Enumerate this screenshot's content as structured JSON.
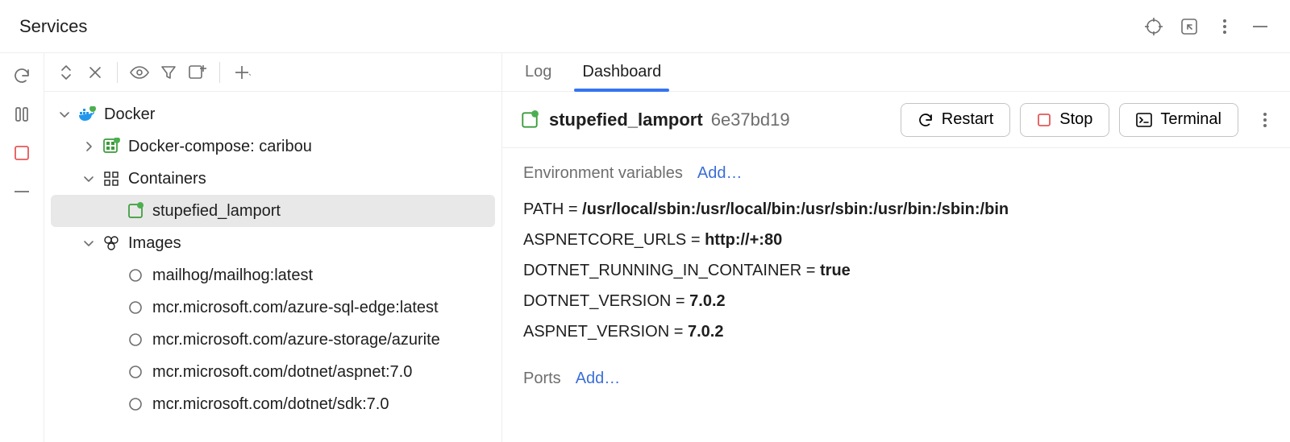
{
  "header": {
    "title": "Services"
  },
  "tree": {
    "root": {
      "label": "Docker",
      "compose": {
        "label": "Docker-compose: caribou"
      },
      "containers": {
        "label": "Containers",
        "items": [
          {
            "name": "stupefied_lamport"
          }
        ]
      },
      "images": {
        "label": "Images",
        "items": [
          {
            "name": "mailhog/mailhog:latest"
          },
          {
            "name": "mcr.microsoft.com/azure-sql-edge:latest"
          },
          {
            "name": "mcr.microsoft.com/azure-storage/azurite"
          },
          {
            "name": "mcr.microsoft.com/dotnet/aspnet:7.0"
          },
          {
            "name": "mcr.microsoft.com/dotnet/sdk:7.0"
          }
        ]
      }
    }
  },
  "detail": {
    "tabs": {
      "log": "Log",
      "dashboard": "Dashboard",
      "active": "dashboard"
    },
    "container": {
      "name": "stupefied_lamport",
      "hash": "6e37bd19"
    },
    "buttons": {
      "restart": "Restart",
      "stop": "Stop",
      "terminal": "Terminal"
    },
    "env": {
      "title": "Environment variables",
      "add": "Add…",
      "vars": [
        {
          "k": "PATH",
          "v": "/usr/local/sbin:/usr/local/bin:/usr/sbin:/usr/bin:/sbin:/bin"
        },
        {
          "k": "ASPNETCORE_URLS",
          "v": "http://+:80"
        },
        {
          "k": "DOTNET_RUNNING_IN_CONTAINER",
          "v": "true"
        },
        {
          "k": "DOTNET_VERSION",
          "v": "7.0.2"
        },
        {
          "k": "ASPNET_VERSION",
          "v": "7.0.2"
        }
      ]
    },
    "ports": {
      "title": "Ports",
      "add": "Add…"
    }
  }
}
